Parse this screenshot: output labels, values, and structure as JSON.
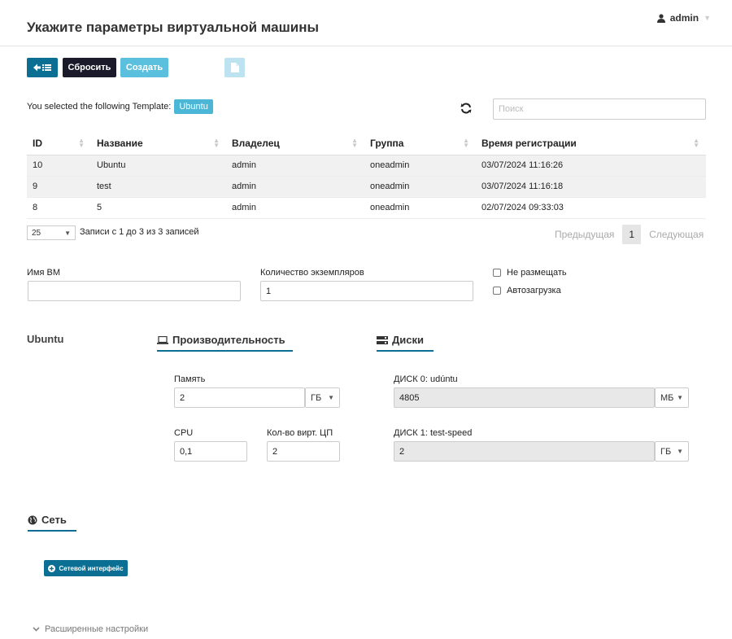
{
  "header": {
    "title": "Укажите параметры виртуальной машины",
    "user": "admin"
  },
  "toolbar": {
    "reset_label": "Сбросить",
    "create_label": "Создать"
  },
  "template": {
    "prefix": "You selected the following Template:",
    "name": "Ubuntu"
  },
  "search": {
    "placeholder": "Поиск"
  },
  "table": {
    "columns": [
      "ID",
      "Название",
      "Владелец",
      "Группа",
      "Время регистрации"
    ],
    "rows": [
      [
        "10",
        "Ubuntu",
        "admin",
        "oneadmin",
        "03/07/2024 11:16:26"
      ],
      [
        "9",
        "test",
        "admin",
        "oneadmin",
        "03/07/2024 11:16:18"
      ],
      [
        "8",
        "5",
        "admin",
        "oneadmin",
        "02/07/2024 09:33:03"
      ]
    ]
  },
  "pagination": {
    "page_size": "25",
    "info": "Записи с 1 до 3 из 3 записей",
    "prev": "Предыдущая",
    "current": "1",
    "next": "Следующая"
  },
  "form": {
    "vm_name_label": "Имя ВМ",
    "vm_name_value": "",
    "instances_label": "Количество экземпляров",
    "instances_value": "1",
    "hold_label": "Не размещать",
    "autostart_label": "Автозагрузка"
  },
  "template_name": "Ubuntu",
  "performance": {
    "tab_label": "Производительность",
    "memory_label": "Память",
    "memory_value": "2",
    "memory_unit": "ГБ",
    "cpu_label": "CPU",
    "cpu_value": "0,1",
    "vcpu_label": "Кол-во вирт. ЦП",
    "vcpu_value": "2"
  },
  "disks": {
    "tab_label": "Диски",
    "disk0_label": "ДИСК 0: udúntu",
    "disk0_value": "4805",
    "disk0_unit": "МБ",
    "disk1_label": "ДИСК 1: test-speed",
    "disk1_value": "2",
    "disk1_unit": "ГБ"
  },
  "network": {
    "tab_label": "Сеть",
    "add_nic_label": "Сетевой интерфейс"
  },
  "advanced": {
    "label": "Расширенные настройки"
  },
  "colors": {
    "primary": "#0a6f93",
    "info": "#5bc0de",
    "dark": "#1a1a2a"
  }
}
